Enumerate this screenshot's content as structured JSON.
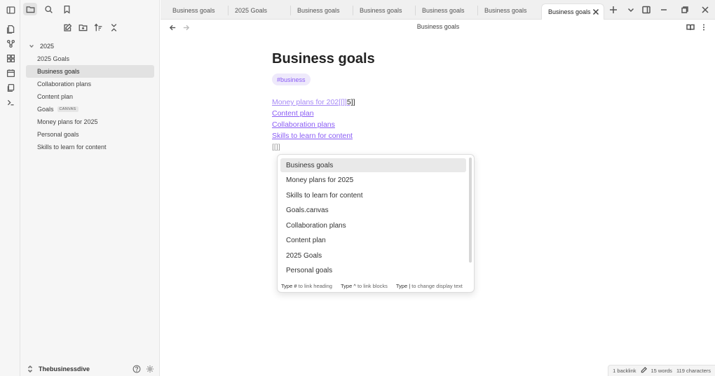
{
  "ribbon": {
    "icons": [
      "open-quick-switcher-icon",
      "graph-view-icon",
      "canvas-icon",
      "daily-note-icon",
      "templates-icon",
      "command-palette-icon"
    ]
  },
  "sidebar": {
    "top_icons": [
      "files-icon",
      "search-icon",
      "bookmark-icon"
    ],
    "actions": [
      "new-note-icon",
      "new-folder-icon",
      "sort-icon",
      "collapse-all-icon"
    ],
    "folder": "2025",
    "files": [
      {
        "label": "2025 Goals",
        "active": false,
        "badge": ""
      },
      {
        "label": "Business goals",
        "active": true,
        "badge": ""
      },
      {
        "label": "Collaboration plans",
        "active": false,
        "badge": ""
      },
      {
        "label": "Content plan",
        "active": false,
        "badge": ""
      },
      {
        "label": "Goals",
        "active": false,
        "badge": "CANVAS"
      },
      {
        "label": "Money plans for 2025",
        "active": false,
        "badge": ""
      },
      {
        "label": "Personal goals",
        "active": false,
        "badge": ""
      },
      {
        "label": "Skills to learn for content",
        "active": false,
        "badge": ""
      }
    ],
    "vault_name": "Thebusinessdive"
  },
  "tabs": {
    "items": [
      "Business goals",
      "2025 Goals",
      "Business goals",
      "Business goals",
      "Business goals",
      "Business goals",
      "Business goals"
    ],
    "active_index": 6
  },
  "header": {
    "title": "Business goals"
  },
  "editor": {
    "title": "Business goals",
    "tag": "#business",
    "link1_text": "Money plans for 202",
    "link1_brackets": "[[]]",
    "link1_tail": "5]]",
    "link2": "Content plan",
    "link3": "Collaboration plans",
    "link4": "Skills to learn for content",
    "bracket_line": "[[]]"
  },
  "suggestions": {
    "items": [
      "Business goals",
      "Money plans for 2025",
      "Skills to learn for content",
      "Goals.canvas",
      "Collaboration plans",
      "Content plan",
      "2025 Goals",
      "Personal goals"
    ],
    "selected_index": 0,
    "hint1_key": "Type #",
    "hint1_text": "to link heading",
    "hint2_key": "Type ^",
    "hint2_text": "to link blocks",
    "hint3_key": "Type |",
    "hint3_text": "to change display text"
  },
  "status": {
    "backlinks": "1 backlink",
    "words": "15 words",
    "characters": "119 characters"
  },
  "colors": {
    "accent": "#8a5cf5",
    "tag_bg": "#eee9fb"
  }
}
